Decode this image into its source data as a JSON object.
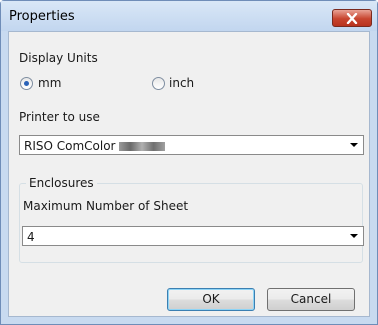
{
  "window": {
    "title": "Properties"
  },
  "display_units": {
    "label": "Display Units",
    "options": [
      {
        "label": "mm",
        "selected": true
      },
      {
        "label": "inch",
        "selected": false
      }
    ]
  },
  "printer": {
    "label": "Printer to use",
    "selected_value": "RISO ComColor"
  },
  "enclosures": {
    "group_label": "Enclosures",
    "max_sheets_label": "Maximum Number of Sheet",
    "max_sheets_value": "4"
  },
  "buttons": {
    "ok": "OK",
    "cancel": "Cancel"
  },
  "colors": {
    "accent": "#2a62b8",
    "titlebar": "#c8daf0",
    "close": "#c8452f"
  }
}
